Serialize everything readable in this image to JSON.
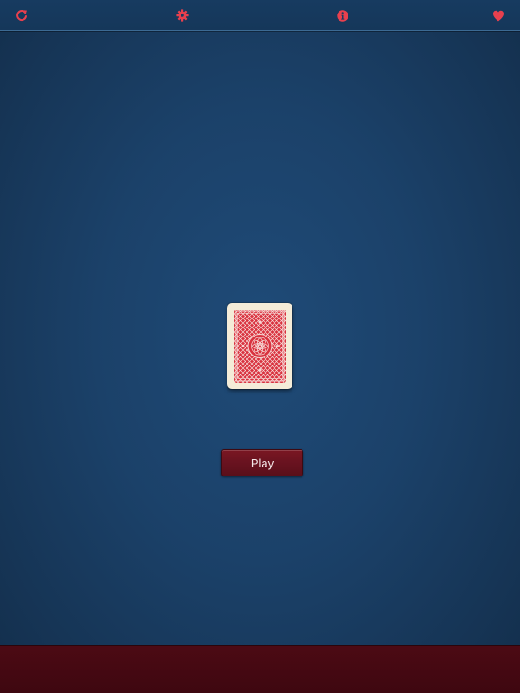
{
  "toolbar": {
    "icons": {
      "refresh": "refresh-icon",
      "settings": "gear-icon",
      "info": "info-icon",
      "favorite": "heart-icon"
    },
    "icon_color": "#e8404e"
  },
  "main": {
    "card": {
      "side": "back",
      "back_color": "#d9323f",
      "border_color": "#f4ecd8"
    },
    "play_button": {
      "label": "Play",
      "color": "#6a1320"
    }
  },
  "colors": {
    "background": "#1b4169",
    "bottom_bar": "#4c0a14"
  }
}
